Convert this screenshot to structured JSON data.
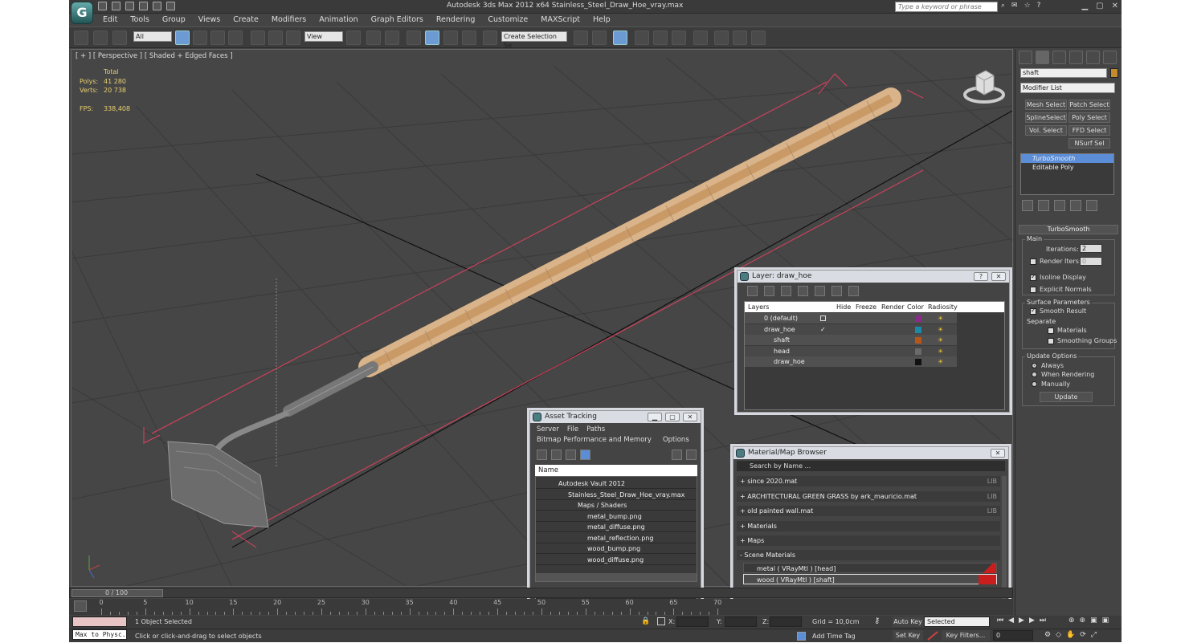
{
  "window": {
    "title": "Autodesk 3ds Max  2012 x64      Stainless_Steel_Draw_Hoe_vray.max",
    "search_placeholder": "Type a keyword or phrase"
  },
  "menu": [
    "Edit",
    "Tools",
    "Group",
    "Views",
    "Create",
    "Modifiers",
    "Animation",
    "Graph Editors",
    "Rendering",
    "Customize",
    "MAXScript",
    "Help"
  ],
  "toolbar": {
    "filter_select": "All",
    "coord_select": "View",
    "selection_set": "Create Selection Se"
  },
  "viewport": {
    "label": "[ + ] [ Perspective ] [ Shaded + Edged Faces ]",
    "stats": {
      "total_label": "Total",
      "polys_label": "Polys:",
      "polys": "41 280",
      "verts_label": "Verts:",
      "verts": "20 738",
      "fps_label": "FPS:",
      "fps": "338,408"
    }
  },
  "command_panel": {
    "object_name": "shaft",
    "object_color": "#c68a2e",
    "modifier_list": "Modifier List",
    "buttons": [
      "Mesh Select",
      "Patch Select",
      "SplineSelect",
      "Poly Select",
      "Vol. Select",
      "FFD Select",
      "NSurf Sel"
    ],
    "stack": [
      "TurboSmooth",
      "Editable Poly"
    ],
    "rollout_title": "TurboSmooth",
    "main_group": "Main",
    "iterations_label": "Iterations:",
    "iterations": "2",
    "render_iters_label": "Render Iters:",
    "render_iters": "0",
    "isoline_label": "Isoline Display",
    "explicit_label": "Explicit Normals",
    "surface_group": "Surface Parameters",
    "smooth_result_label": "Smooth Result",
    "separate_label": "Separate",
    "materials_label": "Materials",
    "smoothing_label": "Smoothing Groups",
    "update_group": "Update Options",
    "always_label": "Always",
    "when_render_label": "When Rendering",
    "manually_label": "Manually",
    "update_button": "Update"
  },
  "layer_window": {
    "title": "Layer: draw_hoe",
    "columns": [
      "Layers",
      "Hide",
      "Freeze",
      "Render",
      "Color",
      "Radiosity"
    ],
    "rows": [
      {
        "name": "0 (default)",
        "color": "#8a2a8a"
      },
      {
        "name": "draw_hoe",
        "color": "#1a8aa8"
      },
      {
        "name": "shaft",
        "color": "#b8561a"
      },
      {
        "name": "head",
        "color": "#6a6a6a"
      },
      {
        "name": "draw_hoe",
        "color": "#111111"
      }
    ]
  },
  "asset_window": {
    "title": "Asset Tracking",
    "menu1": [
      "Server",
      "File",
      "Paths"
    ],
    "menu2": [
      "Bitmap Performance and Memory",
      "Options"
    ],
    "column": "Name",
    "rows": [
      "Autodesk Vault 2012",
      "Stainless_Steel_Draw_Hoe_vray.max",
      "Maps / Shaders",
      "metal_bump.png",
      "metal_diffuse.png",
      "metal_reflection.png",
      "wood_bump.png",
      "wood_diffuse.png"
    ]
  },
  "material_window": {
    "title": "Material/Map Browser",
    "search_placeholder": "Search by Name ...",
    "libraries": [
      "+ since 2020.mat",
      "+ ARCHITECTURAL GREEN GRASS by ark_mauricio.mat",
      "+ old painted wall.mat"
    ],
    "lib_tag": "LIB",
    "groups": [
      "+ Materials",
      "+ Maps",
      "- Scene Materials"
    ],
    "scene_materials": [
      "metal  ( VRayMtl ) [head]",
      "wood  ( VRayMtl ) [shaft]"
    ]
  },
  "timeline": {
    "frame": "0 / 100",
    "ticks": [
      "0",
      "5",
      "10",
      "15",
      "20",
      "25",
      "30",
      "35",
      "40",
      "45",
      "50",
      "55",
      "60",
      "65",
      "70"
    ]
  },
  "status": {
    "maxscript": "Max to Physc.",
    "selected": "1 Object Selected",
    "prompt": "Click or click-and-drag to select objects",
    "x_label": "X:",
    "y_label": "Y:",
    "z_label": "Z:",
    "grid": "Grid = 10,0cm",
    "add_time_tag": "Add Time Tag",
    "auto_key": "Auto Key",
    "selected_select": "Selected",
    "set_key": "Set Key",
    "key_filters": "Key Filters...",
    "frame_field": "0"
  }
}
